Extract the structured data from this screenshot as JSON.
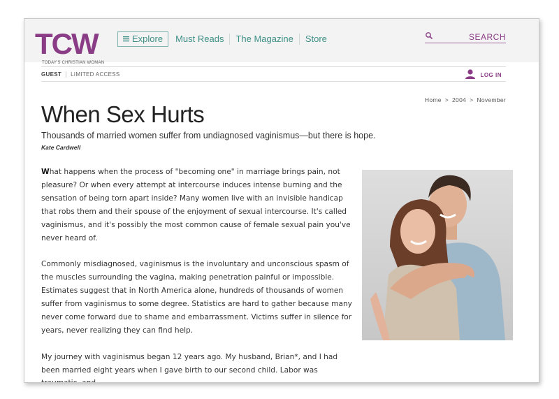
{
  "brand": {
    "logo": "TCW",
    "tagline": "TODAY'S CHRISTIAN WOMAN",
    "accent": "#8a3d86",
    "nav_color": "#3f8f86"
  },
  "nav": {
    "explore": "Explore",
    "items": [
      "Must Reads",
      "The Magazine",
      "Store"
    ]
  },
  "search": {
    "label": "SEARCH",
    "icon": "search-icon"
  },
  "account": {
    "status": "GUEST",
    "access": "LIMITED ACCESS",
    "login": "LOG IN",
    "icon": "user-icon"
  },
  "breadcrumb": [
    "Home",
    ">",
    "2004",
    ">",
    "November"
  ],
  "article": {
    "title": "When Sex Hurts",
    "subtitle": "Thousands of married women suffer from undiagnosed vaginismus—but there is hope.",
    "author": "Kate Cardwell",
    "p1_cap": "W",
    "p1_rest": "hat happens when the process of \"becoming one\" in marriage brings pain, not pleasure? Or when every attempt at intercourse induces intense burning and the sensation of being torn apart inside? Many women live with an invisible handicap that robs them and their spouse of the enjoyment of sexual intercourse. It's called vaginismus, and it's possibly the most common cause of female sexual pain you've never heard of.",
    "p2": "Commonly misdiagnosed, vaginismus is the involuntary and unconscious spasm of the muscles surrounding the vagina, making penetration painful or impossible. Estimates suggest that in North America alone, hundreds of thousands of women suffer from vaginismus to some degree. Statistics are hard to gather because many never come forward due to shame and embarrassment. Victims suffer in silence for years, never realizing they can find help.",
    "p3": "My journey with vaginismus began 12 years ago. My husband, Brian*, and I had been married eight years when I gave birth to our second child. Labor was traumatic, and"
  }
}
